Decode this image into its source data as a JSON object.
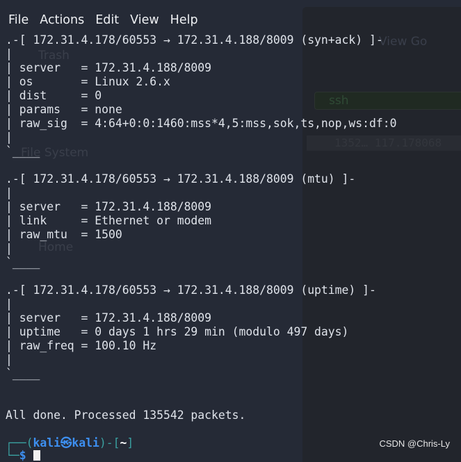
{
  "menu": [
    "File",
    "Actions",
    "Edit",
    "View",
    "Help"
  ],
  "background_window": {
    "menu": "View   Go",
    "filter": "ssh",
    "row": "1352…  117.178068",
    "desktop_icons": [
      "Trash",
      "File System",
      "Home"
    ]
  },
  "blocks": [
    {
      "header": ".-[ 172.31.4.178/60553 → 172.31.4.188/8009 (syn+ack) ]-",
      "fields": [
        "| server   = 172.31.4.188/8009",
        "| os       = Linux 2.6.x",
        "| dist     = 0",
        "| params   = none",
        "| raw_sig  = 4:64+0:0:1460:mss*4,5:mss,sok,ts,nop,ws:df:0"
      ]
    },
    {
      "header": ".-[ 172.31.4.178/60553 → 172.31.4.188/8009 (mtu) ]-",
      "fields": [
        "| server   = 172.31.4.188/8009",
        "| link     = Ethernet or modem",
        "| raw_mtu  = 1500"
      ]
    },
    {
      "header": ".-[ 172.31.4.178/60553 → 172.31.4.188/8009 (uptime) ]-",
      "fields": [
        "| server   = 172.31.4.188/8009",
        "| uptime   = 0 days 1 hrs 29 min (modulo 497 days)",
        "| raw_freq = 100.10 Hz"
      ]
    }
  ],
  "pipe": "|",
  "footer": "`____",
  "summary": "All done. Processed 135542 packets.",
  "prompt": {
    "corner_top": "┌──(",
    "user": "kali㉿kali",
    "close": ")-[",
    "dir": "~",
    "end": "]",
    "corner_bottom": "└─",
    "symbol": "$"
  },
  "watermark": "CSDN @Chris-Ly"
}
